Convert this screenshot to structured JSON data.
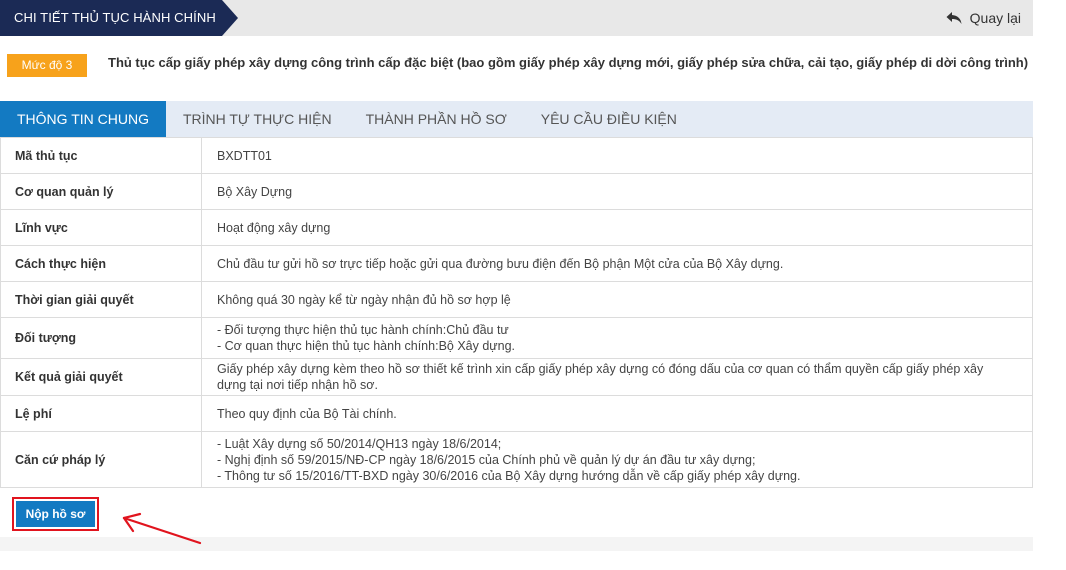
{
  "header": {
    "title": "CHI TIẾT THỦ TỤC HÀNH CHÍNH",
    "back_label": "Quay lại",
    "back_icon": "reply-arrow-icon"
  },
  "procedure": {
    "level": "Mức độ 3",
    "title": "Thủ tục cấp giấy phép xây dựng công trình cấp đặc biệt (bao gồm giấy phép xây dựng mới, giấy phép sửa chữa, cải tạo, giấy phép di dời công trình)"
  },
  "tabs": [
    {
      "label": "THÔNG TIN CHUNG",
      "active": true
    },
    {
      "label": "TRÌNH TỰ THỰC HIỆN",
      "active": false
    },
    {
      "label": "THÀNH PHẦN HỒ SƠ",
      "active": false
    },
    {
      "label": "YÊU CẦU ĐIỀU KIỆN",
      "active": false
    }
  ],
  "rows": {
    "ma_thu_tuc": {
      "label": "Mã thủ tục",
      "value": "BXDTT01"
    },
    "co_quan": {
      "label": "Cơ quan quản lý",
      "value": "Bộ Xây Dựng"
    },
    "linh_vuc": {
      "label": "Lĩnh vực",
      "value": "Hoạt động xây dựng"
    },
    "cach_thuc": {
      "label": "Cách thực hiện",
      "value": "Chủ đầu tư gửi hồ sơ trực tiếp hoặc gửi qua đường bưu điện đến Bộ phận Một cửa của Bộ Xây dựng."
    },
    "thoi_gian": {
      "label": "Thời gian giải quyết",
      "value": "Không quá 30 ngày kể từ ngày nhận đủ hồ sơ hợp lệ"
    },
    "doi_tuong": {
      "label": "Đối tượng",
      "lines": [
        "- Đối tượng thực hiện thủ tục hành chính:Chủ đầu tư",
        "- Cơ quan thực hiện thủ tục hành chính:Bộ Xây dựng."
      ]
    },
    "ket_qua": {
      "label": "Kết quả giải quyết",
      "lines": [
        "Giấy phép xây dựng kèm theo hồ sơ thiết kế trình xin cấp giấy phép xây dựng có đóng dấu của cơ quan có thẩm quyền cấp giấy phép xây",
        "dựng tại nơi tiếp nhận hồ sơ."
      ]
    },
    "le_phi": {
      "label": "Lệ phí",
      "value": "Theo quy định của Bộ Tài chính."
    },
    "can_cu": {
      "label": "Căn cứ pháp lý",
      "lines": [
        "- Luật Xây dựng số 50/2014/QH13 ngày 18/6/2014;",
        "- Nghị định số 59/2015/NĐ-CP ngày 18/6/2015 của Chính phủ về quản lý dự án đầu tư xây dựng;",
        "- Thông tư số 15/2016/TT-BXD ngày 30/6/2016 của Bộ Xây dựng hướng dẫn về cấp giấy phép xây dựng."
      ]
    }
  },
  "submit": {
    "label": "Nộp hồ sơ"
  },
  "colors": {
    "header_dark": "#1b2a55",
    "accent_blue": "#137ac2",
    "level_orange": "#f7a21b",
    "annotation_red": "#e1141e"
  }
}
